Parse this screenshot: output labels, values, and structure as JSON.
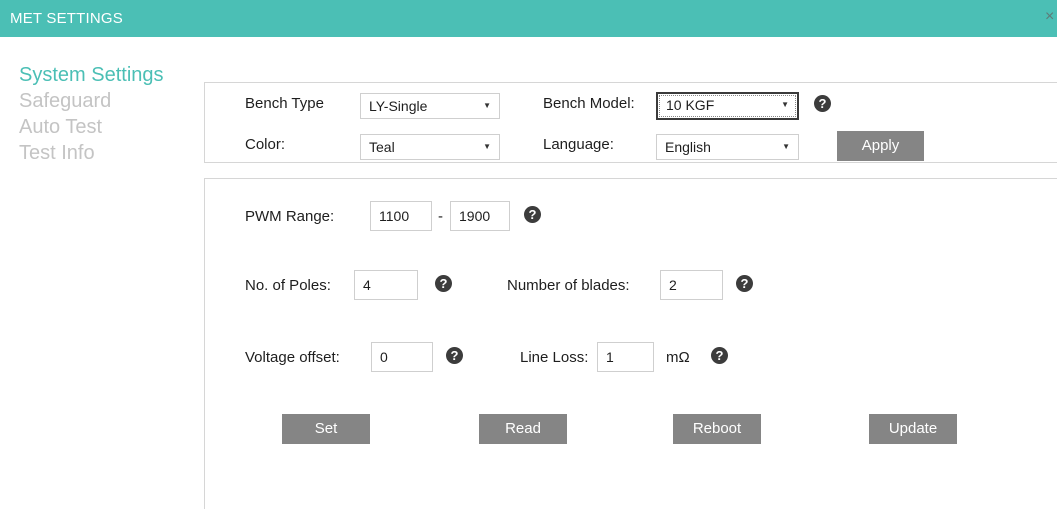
{
  "window": {
    "title": "MET SETTINGS",
    "close_glyph": "×"
  },
  "nav": {
    "items": [
      {
        "label": "System Settings",
        "active": true
      },
      {
        "label": "Safeguard"
      },
      {
        "label": "Auto Test"
      },
      {
        "label": "Test Info"
      }
    ]
  },
  "general": {
    "bench_type_label": "Bench Type",
    "bench_type_value": "LY-Single",
    "bench_model_label": "Bench Model:",
    "bench_model_value": "10 KGF",
    "color_label": "Color:",
    "color_value": "Teal",
    "language_label": "Language:",
    "language_value": "English",
    "apply_label": "Apply"
  },
  "motor": {
    "pwm_label": "PWM Range:",
    "pwm_min": "1100",
    "pwm_sep": "-",
    "pwm_max": "1900",
    "poles_label": "No. of Poles:",
    "poles_value": "4",
    "blades_label": "Number of blades:",
    "blades_value": "2",
    "voltage_offset_label": "Voltage offset:",
    "voltage_offset_value": "0",
    "line_loss_label": "Line Loss:",
    "line_loss_value": "1",
    "line_loss_unit": "mΩ"
  },
  "actions": {
    "set": "Set",
    "read": "Read",
    "reboot": "Reboot",
    "update": "Update"
  },
  "help_glyph": "?",
  "dropdown_glyph": "▼",
  "colors": {
    "accent": "#4bbfb5",
    "button": "#858585",
    "nav_inactive": "#c4c4c4"
  },
  "icons": {
    "help": "question-circle-icon",
    "dropdown": "chevron-down-icon",
    "close": "close-icon"
  }
}
